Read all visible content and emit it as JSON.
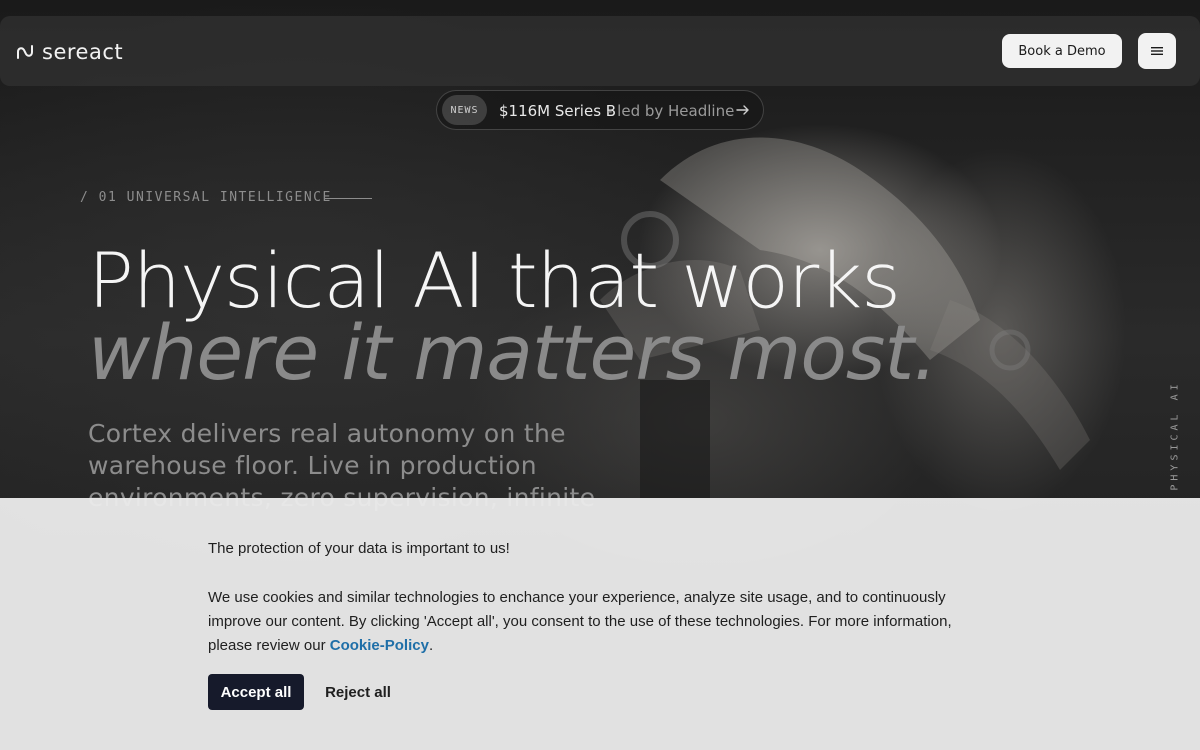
{
  "header": {
    "logo_text": "sereact",
    "demo_button": "Book a Demo",
    "menu_icon": "hamburger-icon"
  },
  "news": {
    "badge": "NEWS",
    "title": "$116M Series B",
    "subtitle": "- led by Headline",
    "arrow_icon": "arrow-right-icon"
  },
  "hero": {
    "section_label": "/ 01 UNIVERSAL INTELLIGENCE",
    "headline_line1": "Physical AI that works",
    "headline_line2": "where it matters most.",
    "description": "Cortex delivers real autonomy on the warehouse floor. Live in production environments, zero supervision, infinite",
    "vertical_label": "PHYSICAL AI"
  },
  "cookie_banner": {
    "heading": "The protection of your data is important to us!",
    "body_text": "We use cookies and similar technologies to enchance your experience, analyze site usage, and to continuously improve our content. By clicking 'Accept all', you consent to the use of these technologies. For more information, please review our",
    "link_text": "Cookie-Policy",
    "trailing": ".",
    "accept_label": "Accept all",
    "reject_label": "Reject all"
  },
  "colors": {
    "accept_bg": "#161a2b",
    "link": "#1f6fa8",
    "banner_bg": "#ececec"
  }
}
